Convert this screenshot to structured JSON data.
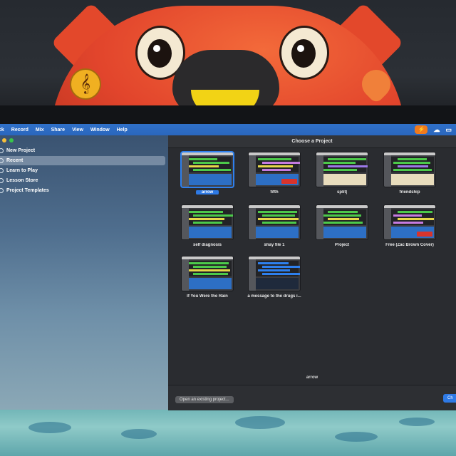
{
  "menubar": {
    "items": [
      "ck",
      "Record",
      "Mix",
      "Share",
      "View",
      "Window",
      "Help"
    ],
    "status_badge": "⚡"
  },
  "sidebar": {
    "items": [
      {
        "label": "New Project",
        "active": false
      },
      {
        "label": "Recent",
        "active": true
      },
      {
        "label": "Learn to Play",
        "active": false
      },
      {
        "label": "Lesson Store",
        "active": false
      },
      {
        "label": "Project Templates",
        "active": false
      }
    ]
  },
  "main": {
    "title": "Choose a Project",
    "projects": [
      {
        "name": "arrow",
        "selected": true,
        "style": "blue"
      },
      {
        "name": "fifth",
        "selected": false,
        "style": "red"
      },
      {
        "name": "split|",
        "selected": false,
        "style": "cream"
      },
      {
        "name": "friendship",
        "selected": false,
        "style": "cream"
      },
      {
        "name": "self diagnosis",
        "selected": false,
        "style": "blue"
      },
      {
        "name": "shay file 1",
        "selected": false,
        "style": "blue"
      },
      {
        "name": "Project",
        "selected": false,
        "style": "blue"
      },
      {
        "name": "Free (Zac Brown Cover)",
        "selected": false,
        "style": "red"
      },
      {
        "name": "If You Were the Rain",
        "selected": false,
        "style": "blue"
      },
      {
        "name": "a message to the drugs i...",
        "selected": false,
        "style": "dark"
      }
    ],
    "selected_name": "arrow",
    "open_button": "Open an existing project...",
    "choose_button": "Ch"
  },
  "colors": {
    "menubar": "#2a66bd",
    "accent": "#2e7ae6",
    "window_bg": "#2a2c30"
  }
}
